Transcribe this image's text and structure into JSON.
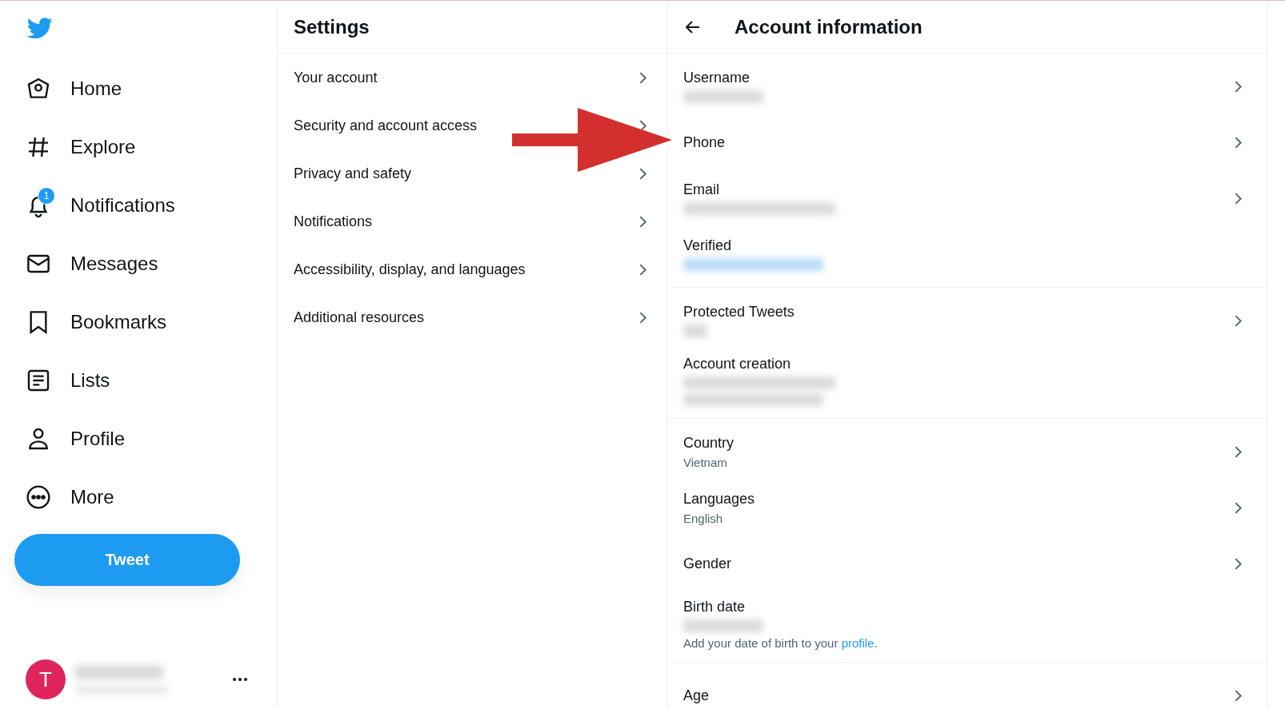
{
  "nav": [
    {
      "label": "Home",
      "kind": "home"
    },
    {
      "label": "Explore",
      "kind": "hash"
    },
    {
      "label": "Notifications",
      "kind": "bell",
      "badge": "1"
    },
    {
      "label": "Messages",
      "kind": "mail"
    },
    {
      "label": "Bookmarks",
      "kind": "bookmark"
    },
    {
      "label": "Lists",
      "kind": "list"
    },
    {
      "label": "Profile",
      "kind": "person"
    },
    {
      "label": "More",
      "kind": "more"
    }
  ],
  "tweet_button": "Tweet",
  "account": {
    "avatar_letter": "T"
  },
  "settings": {
    "title": "Settings",
    "items": [
      "Your account",
      "Security and account access",
      "Privacy and safety",
      "Notifications",
      "Accessibility, display, and languages",
      "Additional resources"
    ]
  },
  "details": {
    "title": "Account information",
    "groups": [
      [
        {
          "label": "Username",
          "kind": "blur_medium",
          "chevron": true
        },
        {
          "label": "Phone",
          "kind": "plain",
          "chevron": true
        },
        {
          "label": "Email",
          "kind": "blur_long",
          "chevron": true
        },
        {
          "label": "Verified",
          "kind": "blur_link",
          "chevron": false
        }
      ],
      [
        {
          "label": "Protected Tweets",
          "kind": "blur_short",
          "chevron": true
        },
        {
          "label": "Account creation",
          "kind": "blur_two_lines",
          "chevron": false
        }
      ],
      [
        {
          "label": "Country",
          "kind": "value",
          "value": "Vietnam",
          "chevron": true
        },
        {
          "label": "Languages",
          "kind": "value",
          "value": "English",
          "chevron": true
        },
        {
          "label": "Gender",
          "kind": "plain",
          "chevron": true
        },
        {
          "label": "Birth date",
          "kind": "blur_medium",
          "note": "Add your date of birth to your ",
          "note_link": "profile",
          "note_end": ".",
          "chevron": false
        }
      ],
      [
        {
          "label": "Age",
          "kind": "plain",
          "chevron": true
        }
      ]
    ]
  }
}
